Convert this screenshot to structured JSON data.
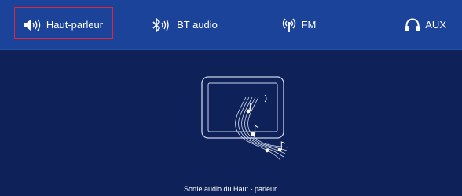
{
  "tabs": [
    {
      "label": "Haut-parleur",
      "icon": "speaker-icon",
      "selected": true
    },
    {
      "label": "BT audio",
      "icon": "bluetooth-icon",
      "selected": false
    },
    {
      "label": "FM",
      "icon": "radio-icon",
      "selected": false
    },
    {
      "label": "AUX",
      "icon": "headphones-icon",
      "selected": false
    }
  ],
  "colors": {
    "tabbar_bg": "#1b4399",
    "content_bg": "#0e2158",
    "selection_border": "#e0263c",
    "text": "#ffffff"
  },
  "content": {
    "illustration": "tablet-music-icon",
    "caption": "Sortie audio du Haut - parleur."
  }
}
